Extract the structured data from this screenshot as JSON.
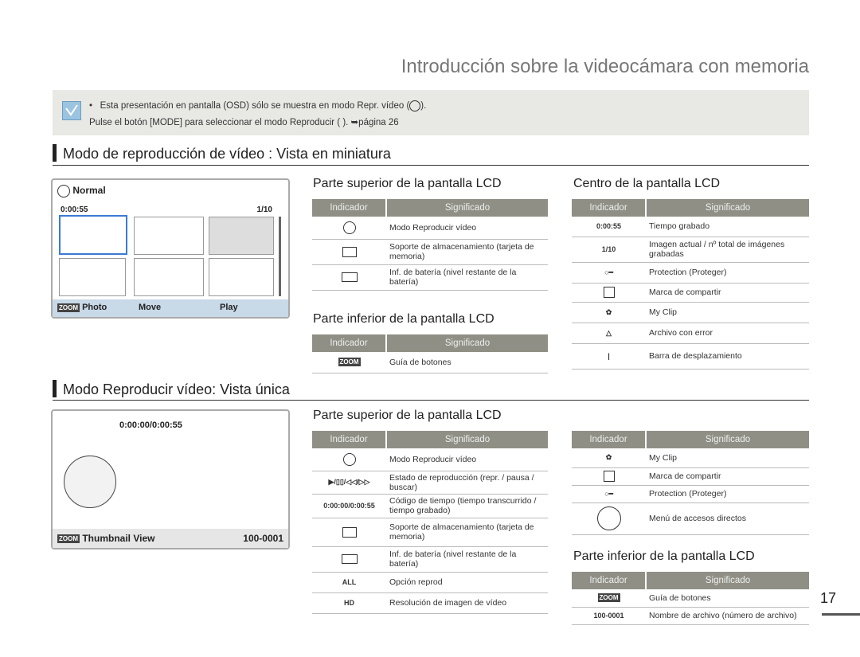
{
  "title": "Introducción sobre la videocámara con memoria",
  "notes": [
    "Esta presentación en pantalla (OSD) sólo se muestra en modo Repr. vídeo (",
    ")."
  ],
  "note2": "Pulse el botón [MODE] para seleccionar el modo Reproducir ( ). ➥página 26",
  "section1": "Modo de reproducción de vídeo : Vista en miniatura",
  "section2": "Modo Reproducir vídeo: Vista única",
  "thumb": {
    "mode": "Normal",
    "time": "0:00:55",
    "count": "1/10",
    "photo": "Photo",
    "move": "Move",
    "play": "Play",
    "zoom": "ZOOM"
  },
  "single": {
    "tc": "0:00:00/0:00:55",
    "thumbview": "Thumbnail View",
    "file": "100-0001",
    "zoom": "ZOOM"
  },
  "hdr": {
    "ind": "Indicador",
    "sig": "Significado"
  },
  "h_sup1": "Parte superior de la pantalla LCD",
  "h_inf1": "Parte inferior de la pantalla LCD",
  "h_cen": "Centro de la pantalla LCD",
  "h_sup2": "Parte superior de la pantalla LCD",
  "h_inf2": "Parte inferior de la pantalla LCD",
  "t1": [
    "Modo Reproducir vídeo",
    "Soporte de almacenamiento (tarjeta de memoria)",
    "Inf. de batería (nivel restante de la batería)"
  ],
  "t2": [
    "Guía de botones"
  ],
  "t3": [
    [
      "0:00:55",
      "Tiempo grabado"
    ],
    [
      "1/10",
      "Imagen actual / nº total de imágenes grabadas"
    ],
    [
      "",
      "Protection (Proteger)"
    ],
    [
      "",
      "Marca de compartir"
    ],
    [
      "",
      "My Clip"
    ],
    [
      "",
      "Archivo con error"
    ],
    [
      "",
      "Barra de desplazamiento"
    ]
  ],
  "t4": [
    [
      "",
      "Modo Reproducir vídeo"
    ],
    [
      "▶/▯▯/◁◁/▷▷",
      "Estado de reproducción (repr. / pausa / buscar)"
    ],
    [
      "0:00:00/0:00:55",
      "Código de tiempo (tiempo transcurrido / tiempo grabado)"
    ],
    [
      "",
      "Soporte de almacenamiento (tarjeta de memoria)"
    ],
    [
      "",
      "Inf. de batería (nivel restante de la batería)"
    ],
    [
      "",
      "Opción reprod"
    ],
    [
      "HD",
      "Resolución de imagen de vídeo"
    ]
  ],
  "t5": [
    [
      "",
      "My Clip"
    ],
    [
      "",
      "Marca de compartir"
    ],
    [
      "",
      "Protection (Proteger)"
    ],
    [
      "",
      "Menú de accesos directos"
    ]
  ],
  "t6": [
    [
      "ZOOM",
      "Guía de botones"
    ],
    [
      "100-0001",
      "Nombre de archivo (número de archivo)"
    ]
  ],
  "page": "17"
}
